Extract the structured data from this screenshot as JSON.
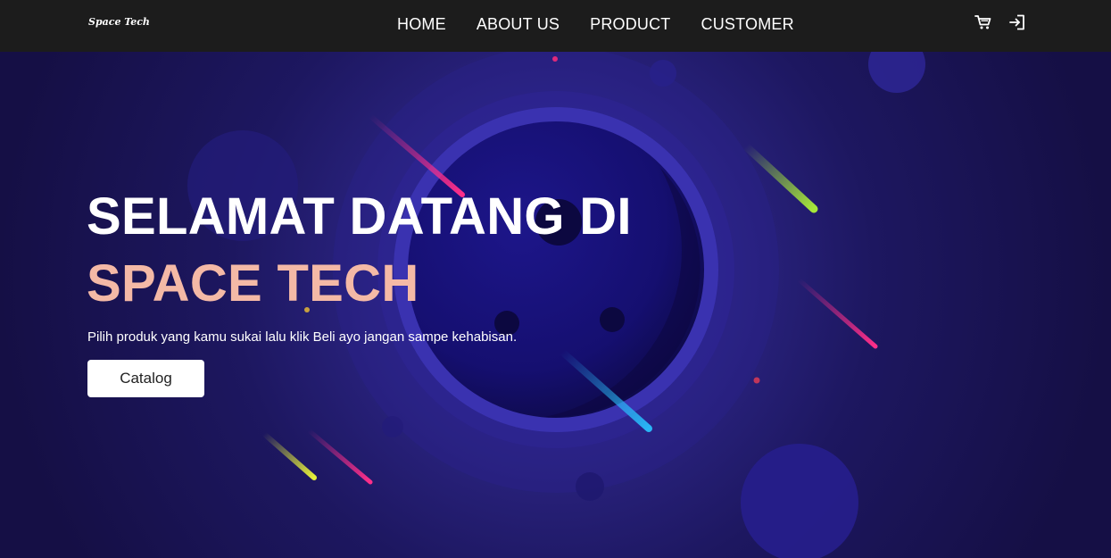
{
  "navbar": {
    "brand": "Space Tech",
    "links": [
      "HOME",
      "ABOUT US",
      "PRODUCT",
      "CUSTOMER"
    ],
    "icons": [
      "cart-icon",
      "login-icon"
    ]
  },
  "hero": {
    "title": "SELAMAT DATANG DI",
    "subtitle": "SPACE TECH",
    "description": "Pilih produk yang kamu sukai lalu klik Beli ayo jangan sampe kehabisan.",
    "button_label": "Catalog"
  },
  "colors": {
    "navbar_bg": "#1c1c1c",
    "hero_bg": "#1d1760",
    "accent_title": "#f4b9a6",
    "button_bg": "#ffffff"
  }
}
